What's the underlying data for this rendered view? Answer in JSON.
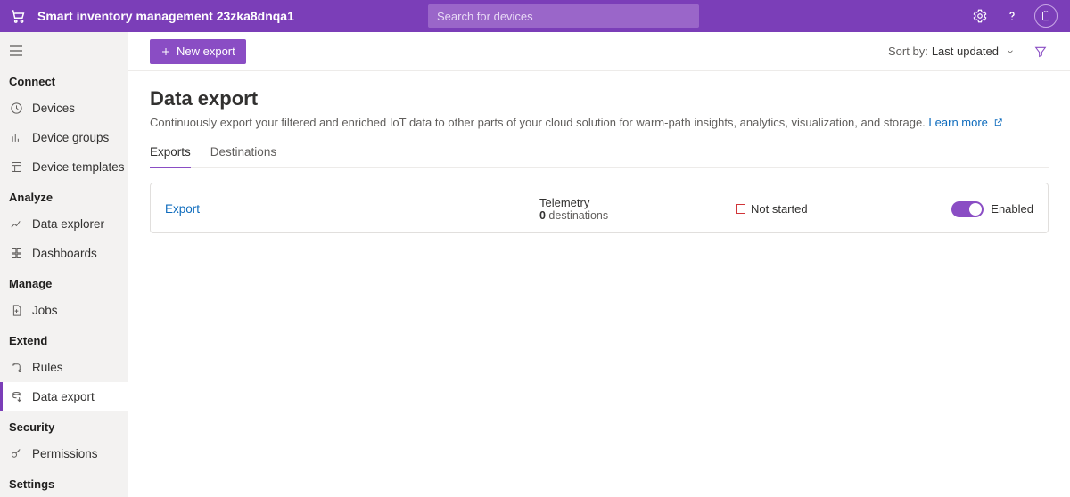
{
  "header": {
    "app_title": "Smart inventory management 23zka8dnqa1",
    "search_placeholder": "Search for devices"
  },
  "sidebar": {
    "sections": [
      {
        "title": "Connect",
        "items": [
          {
            "id": "devices",
            "icon": "clock-icon",
            "label": "Devices"
          },
          {
            "id": "device-groups",
            "icon": "bars-icon",
            "label": "Device groups"
          },
          {
            "id": "device-templates",
            "icon": "template-icon",
            "label": "Device templates"
          }
        ]
      },
      {
        "title": "Analyze",
        "items": [
          {
            "id": "data-explorer",
            "icon": "line-chart-icon",
            "label": "Data explorer"
          },
          {
            "id": "dashboards",
            "icon": "grid-icon",
            "label": "Dashboards"
          }
        ]
      },
      {
        "title": "Manage",
        "items": [
          {
            "id": "jobs",
            "icon": "page-plus-icon",
            "label": "Jobs"
          }
        ]
      },
      {
        "title": "Extend",
        "items": [
          {
            "id": "rules",
            "icon": "flow-icon",
            "label": "Rules"
          },
          {
            "id": "data-export",
            "icon": "export-icon",
            "label": "Data export",
            "active": true
          }
        ]
      },
      {
        "title": "Security",
        "items": [
          {
            "id": "permissions",
            "icon": "key-icon",
            "label": "Permissions"
          }
        ]
      },
      {
        "title": "Settings",
        "items": []
      }
    ]
  },
  "toolbar": {
    "new_export_label": "New export",
    "sort_label": "Sort by:",
    "sort_value": "Last updated"
  },
  "page": {
    "title": "Data export",
    "description": "Continuously export your filtered and enriched IoT data to other parts of your cloud solution for warm-path insights, analytics, visualization, and storage.",
    "learn_more": "Learn more",
    "tabs": [
      {
        "id": "exports",
        "label": "Exports",
        "active": true
      },
      {
        "id": "destinations",
        "label": "Destinations",
        "active": false
      }
    ]
  },
  "export_row": {
    "name": "Export",
    "telemetry_label": "Telemetry",
    "dest_count": "0",
    "dest_suffix": " destinations",
    "status_text": "Not started",
    "toggle_label": "Enabled",
    "toggle_on": true
  }
}
